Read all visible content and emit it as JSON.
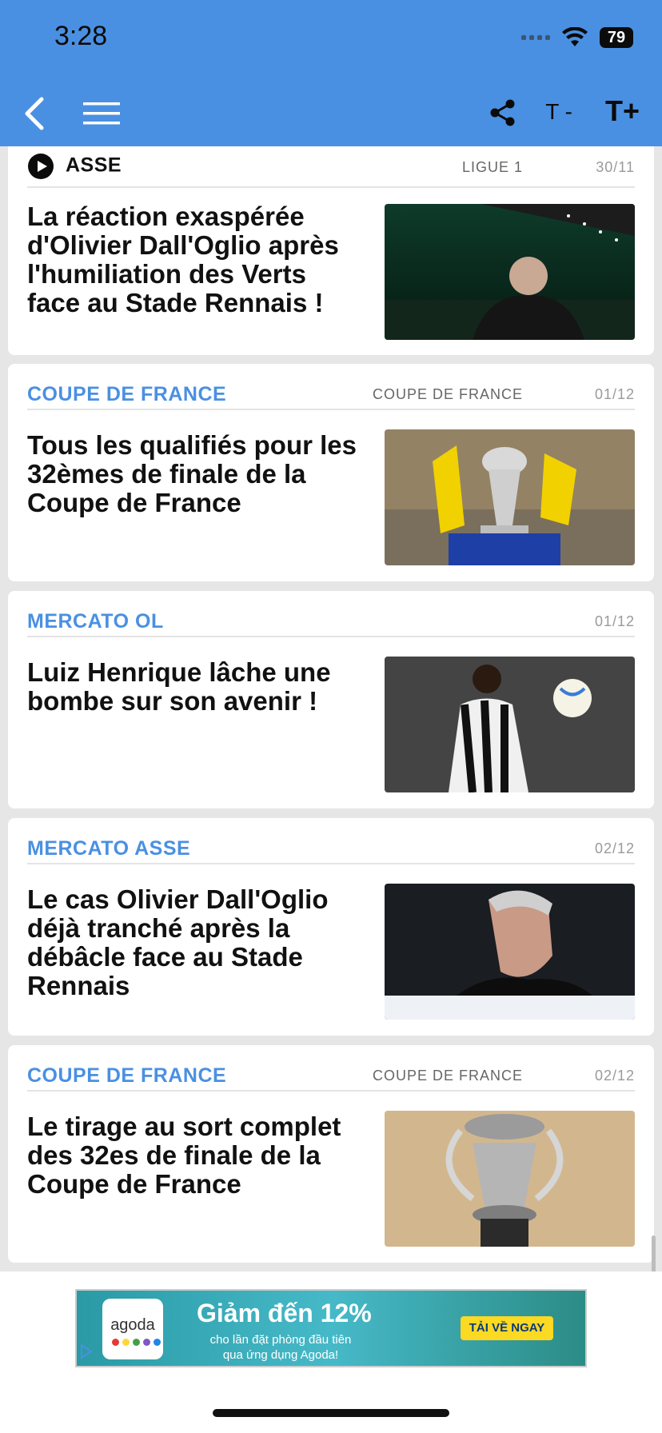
{
  "status_bar": {
    "time": "3:28",
    "battery": "79"
  },
  "toolbar": {
    "text_smaller": "T -",
    "text_larger": "T+"
  },
  "articles": [
    {
      "category": "ASSE",
      "league": "LIGUE 1",
      "date": "30/11",
      "title": "La réaction exaspérée d'Olivier Dall'Oglio après l'humiliation des Verts face au Stade Rennais !"
    },
    {
      "category": "COUPE DE FRANCE",
      "league": "COUPE DE FRANCE",
      "date": "01/12",
      "title": "Tous les qualifiés pour les 32èmes de finale de la Coupe de France"
    },
    {
      "category": "MERCATO OL",
      "league": "",
      "date": "01/12",
      "title": "Luiz Henrique lâche une bombe sur son avenir !"
    },
    {
      "category": "MERCATO ASSE",
      "league": "",
      "date": "02/12",
      "title": "Le cas Olivier Dall'Oglio déjà tranché après la débâcle face au Stade Rennais"
    },
    {
      "category": "COUPE DE FRANCE",
      "league": "COUPE DE FRANCE",
      "date": "02/12",
      "title": "Le tirage au sort complet des 32es de finale de la Coupe de France"
    }
  ],
  "ad": {
    "brand": "agoda",
    "headline": "Giảm đến 12%",
    "subtext": "cho lần đặt phòng đầu tiên qua ứng dụng Agoda!",
    "cta": "TẢI VỀ NGAY"
  }
}
